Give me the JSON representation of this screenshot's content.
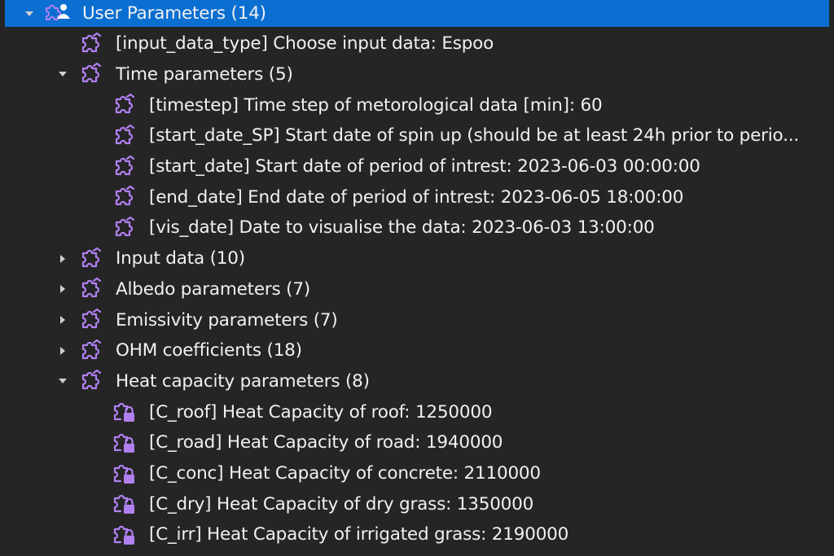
{
  "tree": [
    {
      "label": "User Parameters (14)",
      "level": 0,
      "expander": "expanded",
      "icon": "user-parameters-icon",
      "selected": true
    },
    {
      "label": "[input_data_type] Choose input data: Espoo",
      "level": 1,
      "expander": "none",
      "icon": "parameter-icon"
    },
    {
      "label": "Time parameters (5)",
      "level": 1,
      "expander": "expanded",
      "icon": "parameter-icon"
    },
    {
      "label": "[timestep] Time step of metorological data [min]: 60",
      "level": 2,
      "expander": "none",
      "icon": "parameter-icon"
    },
    {
      "label": "[start_date_SP] Start date of spin up (should be at least 24h prior to perio...",
      "level": 2,
      "expander": "none",
      "icon": "parameter-icon"
    },
    {
      "label": "[start_date] Start date of period of intrest: 2023-06-03 00:00:00",
      "level": 2,
      "expander": "none",
      "icon": "parameter-icon"
    },
    {
      "label": "[end_date] End date of period of intrest: 2023-06-05 18:00:00",
      "level": 2,
      "expander": "none",
      "icon": "parameter-icon"
    },
    {
      "label": "[vis_date] Date to visualise the data: 2023-06-03 13:00:00",
      "level": 2,
      "expander": "none",
      "icon": "parameter-icon"
    },
    {
      "label": "Input data (10)",
      "level": 1,
      "expander": "collapsed",
      "icon": "parameter-icon"
    },
    {
      "label": "Albedo parameters (7)",
      "level": 1,
      "expander": "collapsed",
      "icon": "parameter-icon"
    },
    {
      "label": "Emissivity parameters (7)",
      "level": 1,
      "expander": "collapsed",
      "icon": "parameter-icon"
    },
    {
      "label": "OHM coefficients (18)",
      "level": 1,
      "expander": "collapsed",
      "icon": "parameter-icon"
    },
    {
      "label": "Heat capacity parameters (8)",
      "level": 1,
      "expander": "expanded",
      "icon": "parameter-icon"
    },
    {
      "label": "[C_roof] Heat Capacity of roof: 1250000",
      "level": 2,
      "expander": "none",
      "icon": "locked-parameter-icon"
    },
    {
      "label": "[C_road] Heat Capacity of road: 1940000",
      "level": 2,
      "expander": "none",
      "icon": "locked-parameter-icon"
    },
    {
      "label": "[C_conc] Heat Capacity of concrete: 2110000",
      "level": 2,
      "expander": "none",
      "icon": "locked-parameter-icon"
    },
    {
      "label": "[C_dry] Heat Capacity of dry grass: 1350000",
      "level": 2,
      "expander": "none",
      "icon": "locked-parameter-icon"
    },
    {
      "label": "[C_irr] Heat Capacity of irrigated grass: 2190000",
      "level": 2,
      "expander": "none",
      "icon": "locked-parameter-icon"
    },
    {
      "label": "",
      "level": 2,
      "expander": "none",
      "icon": "locked-parameter-icon"
    }
  ],
  "colors": {
    "background": "#252526",
    "selection": "#0a6fd1",
    "text": "#f1f1f1",
    "icon": "#b180f0",
    "twisty": "#cfcfcf"
  }
}
